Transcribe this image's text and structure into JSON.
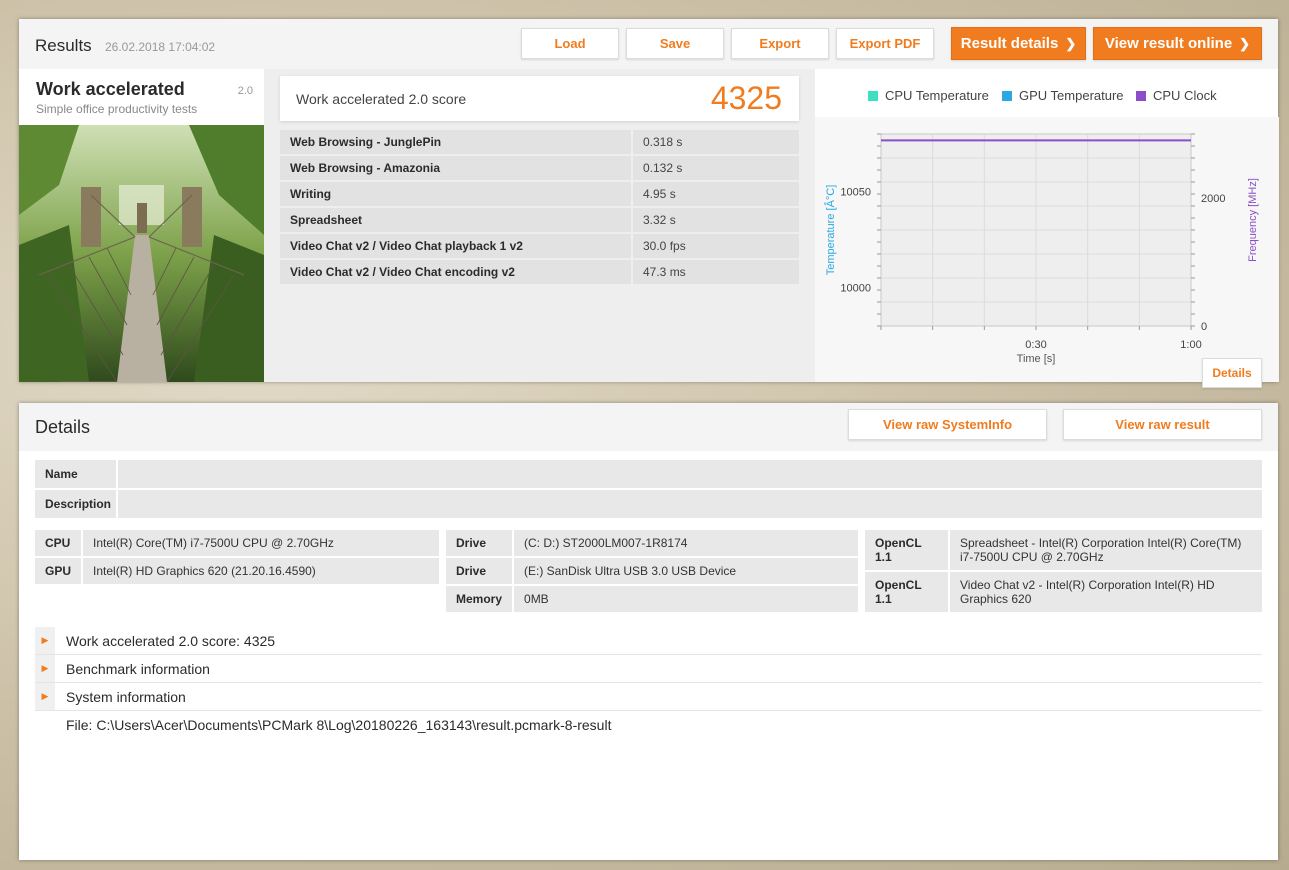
{
  "results": {
    "title": "Results",
    "date": "26.02.2018 17:04:02",
    "buttons": {
      "load": "Load",
      "save": "Save",
      "export": "Export",
      "export_pdf": "Export PDF",
      "result_details": "Result details",
      "view_online": "View result online"
    },
    "test": {
      "name": "Work accelerated",
      "version": "2.0",
      "subtitle": "Simple office productivity tests"
    },
    "score": {
      "label": "Work accelerated 2.0 score",
      "value": "4325"
    },
    "subscores": [
      {
        "name": "Web Browsing - JunglePin",
        "value": "0.318 s"
      },
      {
        "name": "Web Browsing - Amazonia",
        "value": "0.132 s"
      },
      {
        "name": "Writing",
        "value": "4.95 s"
      },
      {
        "name": "Spreadsheet",
        "value": "3.32 s"
      },
      {
        "name": "Video Chat v2 / Video Chat playback 1 v2",
        "value": "30.0 fps"
      },
      {
        "name": "Video Chat v2 / Video Chat encoding v2",
        "value": "47.3 ms"
      }
    ],
    "chart_button": "Details"
  },
  "chart_data": {
    "type": "line",
    "legend": [
      {
        "name": "CPU Temperature",
        "color": "#3de0c0"
      },
      {
        "name": "GPU Temperature",
        "color": "#2aa8e0"
      },
      {
        "name": "CPU Clock",
        "color": "#8a4fc8"
      }
    ],
    "legend_placement": "top",
    "xlabel": "Time [s]",
    "ylabel_left": "Temperature [Â°C]",
    "ylabel_right": "Frequency [MHz]",
    "x_ticks": [
      "0:30",
      "1:00"
    ],
    "y_left_ticks": [
      "10050",
      "10000"
    ],
    "y_right_ticks": [
      "2000",
      "0"
    ],
    "xlim": [
      0,
      60
    ],
    "ylim_left": [
      9980,
      10080
    ],
    "ylim_right": [
      0,
      3000
    ],
    "grid": true,
    "series": [
      {
        "name": "CPU Clock",
        "axis": "right",
        "color": "#8a4fc8",
        "x": [
          0,
          60
        ],
        "values": [
          2900,
          2900
        ]
      }
    ]
  },
  "details": {
    "title": "Details",
    "buttons": {
      "raw_systeminfo": "View raw SystemInfo",
      "raw_result": "View raw result"
    },
    "name_label": "Name",
    "name_value": "",
    "description_label": "Description",
    "description_value": "",
    "hardware": [
      {
        "label": "CPU",
        "value": "Intel(R) Core(TM) i7-7500U CPU @ 2.70GHz"
      },
      {
        "label": "GPU",
        "value": "Intel(R) HD Graphics 620 (21.20.16.4590)"
      }
    ],
    "drives": [
      {
        "label": "Drive",
        "value": "(C: D:) ST2000LM007-1R8174"
      },
      {
        "label": "Drive",
        "value": "(E:) SanDisk Ultra USB 3.0 USB Device"
      },
      {
        "label": "Memory",
        "value": "0MB"
      }
    ],
    "opencl": [
      {
        "label": "OpenCL 1.1",
        "value": "Spreadsheet - Intel(R) Corporation Intel(R) Core(TM) i7-7500U CPU @ 2.70GHz"
      },
      {
        "label": "OpenCL 1.1",
        "value": "Video Chat v2 - Intel(R) Corporation Intel(R) HD Graphics 620"
      }
    ],
    "sections": [
      {
        "label": "Work accelerated 2.0 score: 4325"
      },
      {
        "label": "Benchmark information"
      },
      {
        "label": "System information"
      }
    ],
    "file": "File: C:\\Users\\Acer\\Documents\\PCMark 8\\Log\\20180226_163143\\result.pcmark-8-result"
  }
}
